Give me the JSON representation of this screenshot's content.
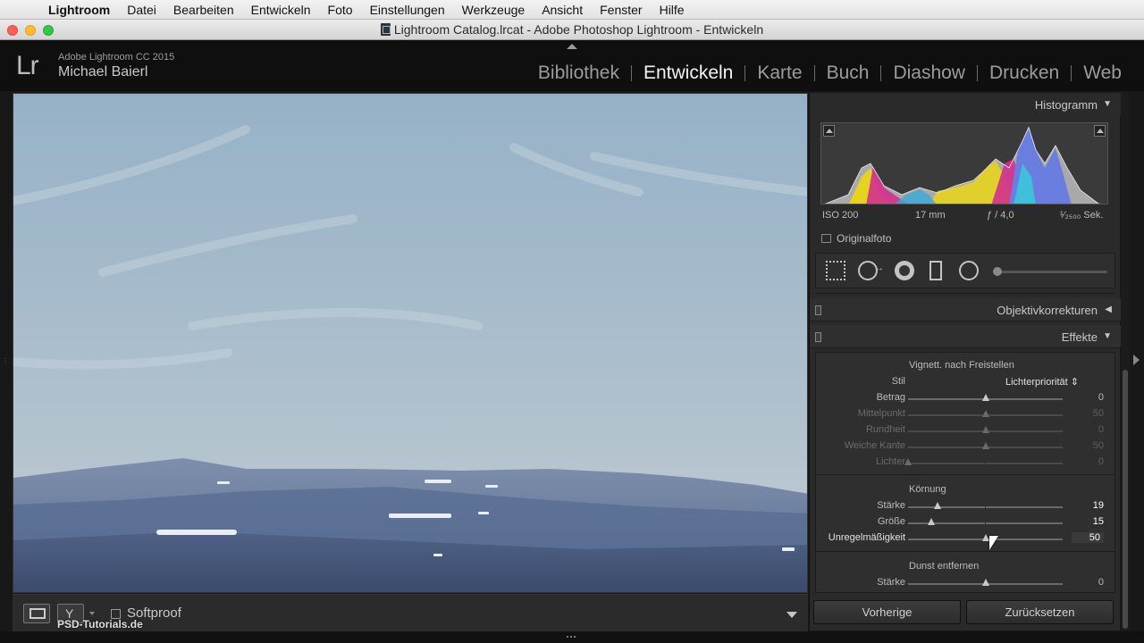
{
  "menubar": {
    "app": "Lightroom",
    "items": [
      "Datei",
      "Bearbeiten",
      "Entwickeln",
      "Foto",
      "Einstellungen",
      "Werkzeuge",
      "Ansicht",
      "Fenster",
      "Hilfe"
    ]
  },
  "window": {
    "title": "Lightroom Catalog.lrcat - Adobe Photoshop Lightroom - Entwickeln"
  },
  "header": {
    "logo": "Lr",
    "product": "Adobe Lightroom CC 2015",
    "user": "Michael Baierl",
    "modules": [
      "Bibliothek",
      "Entwickeln",
      "Karte",
      "Buch",
      "Diashow",
      "Drucken",
      "Web"
    ],
    "active_module": "Entwickeln"
  },
  "toolbar": {
    "softproof_label": "Softproof",
    "watermark": "PSD-Tutorials.de"
  },
  "histogram": {
    "title": "Histogramm",
    "iso": "ISO 200",
    "focal": "17 mm",
    "aperture": "ƒ / 4,0",
    "shutter": "¹⁄₂₅₀₀ Sek.",
    "original_label": "Originalfoto"
  },
  "panels": {
    "lens": "Objektivkorrekturen",
    "effects": "Effekte"
  },
  "vignette": {
    "title": "Vignett. nach Freistellen",
    "style_label": "Stil",
    "style_value": "Lichterpriorität",
    "rows": [
      {
        "label": "Betrag",
        "value": "0",
        "pos": 0.5,
        "dim": false
      },
      {
        "label": "Mittelpunkt",
        "value": "50",
        "pos": 0.5,
        "dim": true
      },
      {
        "label": "Rundheit",
        "value": "0",
        "pos": 0.5,
        "dim": true
      },
      {
        "label": "Weiche Kante",
        "value": "50",
        "pos": 0.5,
        "dim": true
      },
      {
        "label": "Lichter",
        "value": "0",
        "pos": 0.0,
        "dim": true
      }
    ]
  },
  "grain": {
    "title": "Körnung",
    "rows": [
      {
        "label": "Stärke",
        "value": "19",
        "pos": 0.19
      },
      {
        "label": "Größe",
        "value": "15",
        "pos": 0.15
      },
      {
        "label": "Unregelmäßigkeit",
        "value": "50",
        "pos": 0.5
      }
    ]
  },
  "dehaze": {
    "title": "Dunst entfernen",
    "rows": [
      {
        "label": "Stärke",
        "value": "0",
        "pos": 0.5
      }
    ]
  },
  "buttons": {
    "previous": "Vorherige",
    "reset": "Zurücksetzen"
  },
  "colors": {
    "accent": "#f2f2f2",
    "panel": "#2a2a2a",
    "sky": "#9fb6c8",
    "mountain": "#4d5f7e"
  }
}
